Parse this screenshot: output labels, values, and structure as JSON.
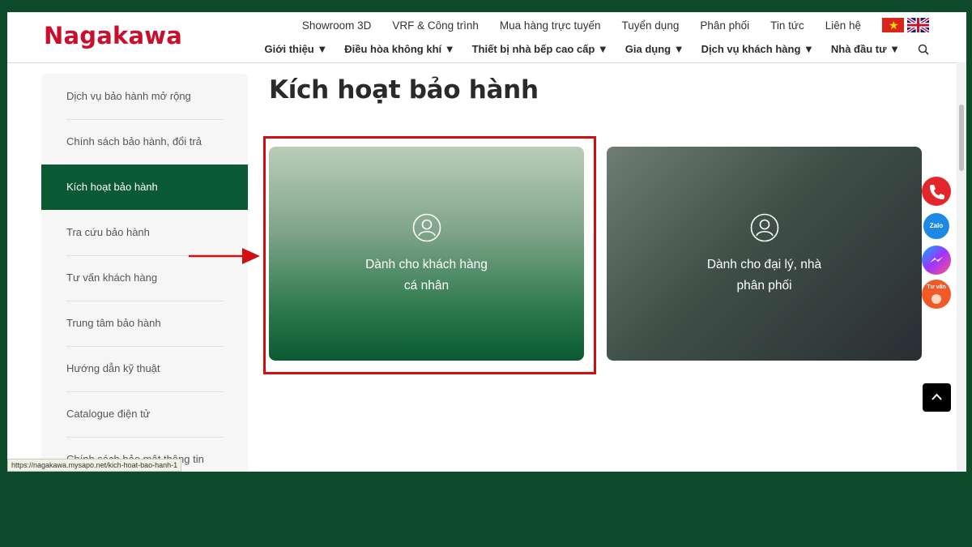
{
  "header": {
    "logo": "Nagakawa",
    "top_links": [
      "Showroom 3D",
      "VRF & Công trình",
      "Mua hàng trực tuyến",
      "Tuyển dụng",
      "Phân phối",
      "Tin tức",
      "Liên hệ"
    ],
    "main_nav": [
      "Giới thiệu ▼",
      "Điều hòa không khí ▼",
      "Thiết bị nhà bếp cao cấp ▼",
      "Gia dụng ▼",
      "Dịch vụ khách hàng ▼",
      "Nhà đầu tư ▼"
    ]
  },
  "sidebar": {
    "items": [
      {
        "label": "Dịch vụ bảo hành mở rộng"
      },
      {
        "label": "Chính sách bảo hành, đổi trả"
      },
      {
        "label": "Kích hoạt bảo hành"
      },
      {
        "label": "Tra cứu bảo hành"
      },
      {
        "label": "Tư vấn khách hàng"
      },
      {
        "label": "Trung tâm bảo hành"
      },
      {
        "label": "Hướng dẫn kỹ thuật"
      },
      {
        "label": "Catalogue điện tử"
      },
      {
        "label": "Chính sách bảo mật thông tin"
      }
    ],
    "active_index": 2
  },
  "main": {
    "title": "Kích hoạt bảo hành",
    "cards": [
      {
        "line1": "Dành cho khách hàng",
        "line2": "cá nhân"
      },
      {
        "line1": "Dành cho đại lý, nhà",
        "line2": "phân phối"
      }
    ]
  },
  "floating": {
    "zalo": "Zalo",
    "advise": "Tư vấn"
  },
  "status_url": "https://nagakawa.mysapo.net/kich-hoat-bao-hanh-1",
  "colors": {
    "brand_red": "#c8102e",
    "brand_green": "#0b5a33",
    "highlight": "#d01010"
  }
}
